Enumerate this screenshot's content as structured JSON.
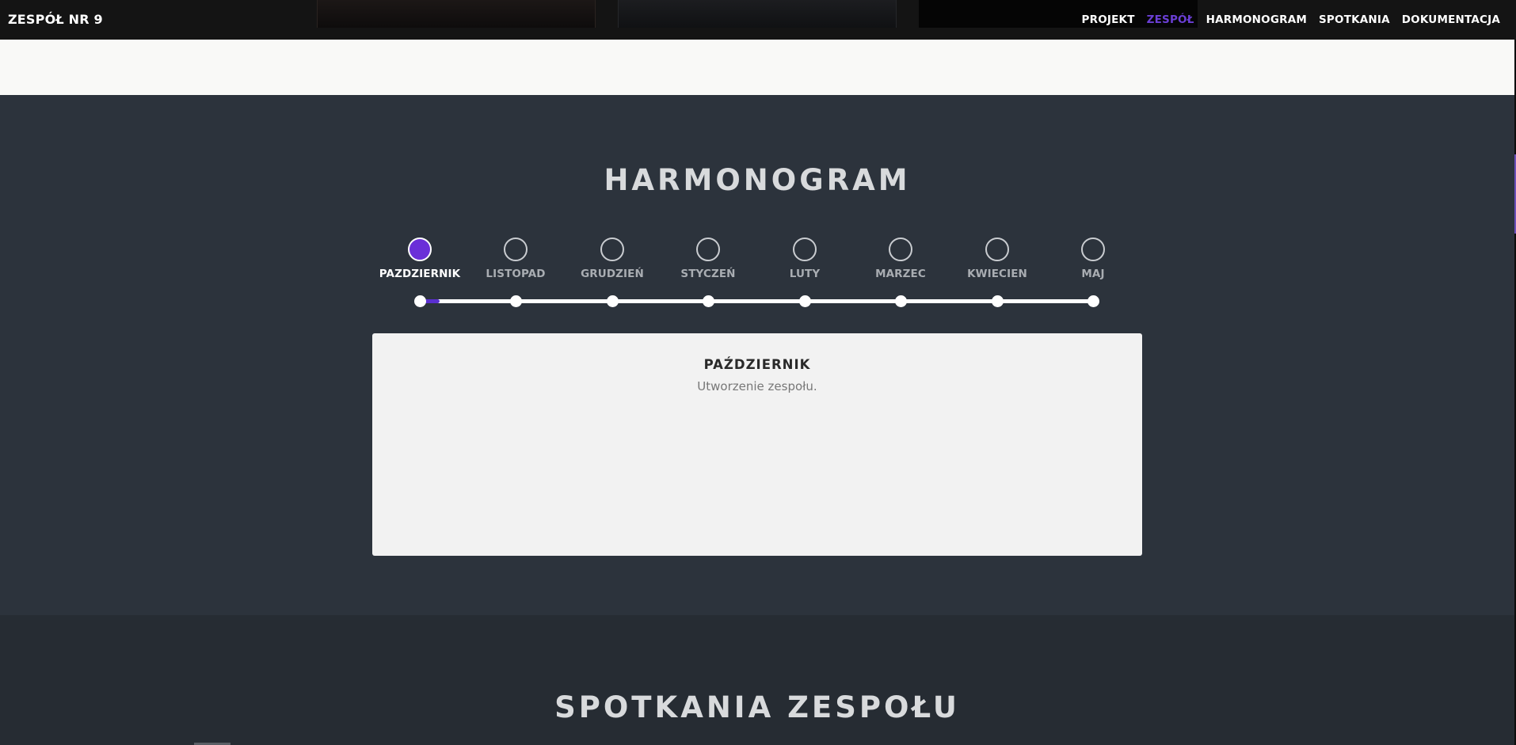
{
  "navbar": {
    "brand": "ZESPÓŁ NR 9",
    "links": [
      {
        "label": "PROJEKT",
        "active": false
      },
      {
        "label": "ZESPÓŁ",
        "active": true
      },
      {
        "label": "HARMONOGRAM",
        "active": false
      },
      {
        "label": "SPOTKANIA",
        "active": false
      },
      {
        "label": "DOKUMENTACJA",
        "active": false
      }
    ]
  },
  "harmonogram": {
    "title": "HARMONOGRAM",
    "months": [
      {
        "label": "PAZDZIERNIK",
        "active": true
      },
      {
        "label": "LISTOPAD",
        "active": false
      },
      {
        "label": "GRUDZIEŃ",
        "active": false
      },
      {
        "label": "STYCZEŃ",
        "active": false
      },
      {
        "label": "LUTY",
        "active": false
      },
      {
        "label": "MARZEC",
        "active": false
      },
      {
        "label": "KWIECIEN",
        "active": false
      },
      {
        "label": "MAJ",
        "active": false
      }
    ],
    "detail": {
      "title": "PAŹDZIERNIK",
      "description": "Utworzenie zespołu."
    }
  },
  "spotkania": {
    "title": "SPOTKANIA ZESPOŁU"
  },
  "colors": {
    "accent": "#6a2fd8",
    "section_bg": "#2c333c",
    "section_alt_bg": "#262c33",
    "navbar_bg": "#141414"
  }
}
